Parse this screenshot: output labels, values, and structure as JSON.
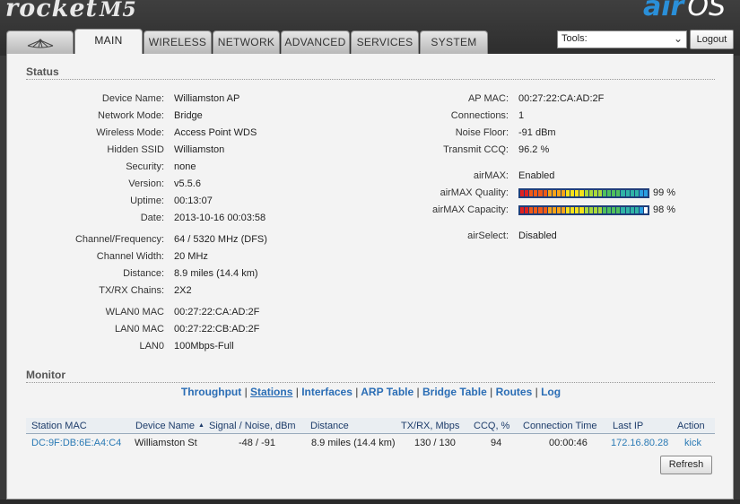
{
  "header": {
    "brand_logo": "rocket",
    "brand_model": "M5",
    "os_logo_air": "air",
    "os_logo_os": "OS",
    "tabs": [
      {
        "label": "",
        "icon": "ubiquiti-logo-icon"
      },
      {
        "label": "MAIN"
      },
      {
        "label": "WIRELESS"
      },
      {
        "label": "NETWORK"
      },
      {
        "label": "ADVANCED"
      },
      {
        "label": "SERVICES"
      },
      {
        "label": "SYSTEM"
      }
    ],
    "active_tab": "MAIN",
    "tools_select": "Tools:",
    "logout_label": "Logout"
  },
  "status": {
    "title": "Status",
    "left": [
      {
        "label": "Device Name:",
        "value": "Williamston AP"
      },
      {
        "label": "Network Mode:",
        "value": "Bridge"
      },
      {
        "label": "Wireless Mode:",
        "value": "Access Point WDS"
      },
      {
        "label": "Hidden SSID",
        "value": "Williamston"
      },
      {
        "label": "Security:",
        "value": "none"
      },
      {
        "label": "Version:",
        "value": "v5.5.6"
      },
      {
        "label": "Uptime:",
        "value": "00:13:07"
      },
      {
        "label": "Date:",
        "value": "2013-10-16 00:03:58"
      },
      {
        "label": "Channel/Frequency:",
        "value": "64 / 5320 MHz (DFS)"
      },
      {
        "label": "Channel Width:",
        "value": "20 MHz"
      },
      {
        "label": "Distance:",
        "value": "8.9 miles (14.4 km)"
      },
      {
        "label": "TX/RX Chains:",
        "value": "2X2"
      },
      {
        "label": "WLAN0 MAC",
        "value": "00:27:22:CA:AD:2F"
      },
      {
        "label": "LAN0 MAC",
        "value": "00:27:22:CB:AD:2F"
      },
      {
        "label": "LAN0",
        "value": "100Mbps-Full"
      }
    ],
    "right": [
      {
        "label": "AP MAC:",
        "value": "00:27:22:CA:AD:2F"
      },
      {
        "label": "Connections:",
        "value": "1"
      },
      {
        "label": "Noise Floor:",
        "value": "-91 dBm"
      },
      {
        "label": "Transmit CCQ:",
        "value": "96.2 %"
      },
      {
        "label": "airMAX:",
        "value": "Enabled"
      },
      {
        "label": "airMAX Quality:",
        "value": "99 %",
        "level": 0.99
      },
      {
        "label": "airMAX Capacity:",
        "value": "98 %",
        "level": 0.98
      },
      {
        "label": "airSelect:",
        "value": "Disabled"
      }
    ]
  },
  "monitor": {
    "title": "Monitor",
    "links": [
      "Throughput",
      "Stations",
      "Interfaces",
      "ARP Table",
      "Bridge Table",
      "Routes",
      "Log"
    ],
    "active_link": "Stations",
    "separator": "|",
    "table": {
      "columns": [
        "Station MAC",
        "Device Name",
        "Signal / Noise, dBm",
        "Distance",
        "TX/RX, Mbps",
        "CCQ, %",
        "Connection Time",
        "Last IP",
        "Action"
      ],
      "sort_indicator": "▲",
      "rows": [
        {
          "station_mac": "DC:9F:DB:6E:A4:C4",
          "device_name": "Williamston St",
          "signal_noise": "-48 / -91",
          "distance": "8.9 miles (14.4 km)",
          "tx_rx": "130 / 130",
          "ccq": "94",
          "connection_time": "00:00:46",
          "last_ip": "172.16.80.28",
          "action": "kick"
        }
      ]
    },
    "refresh_label": "Refresh"
  },
  "colors": {
    "link": "#2a6db5",
    "meter_border": "#1f3e7a",
    "meter_gradient": [
      "#e02020",
      "#f05a18",
      "#f7a318",
      "#f5e21a",
      "#a9d93b",
      "#4fc05d",
      "#2fb3a6",
      "#2a9ee0"
    ]
  }
}
